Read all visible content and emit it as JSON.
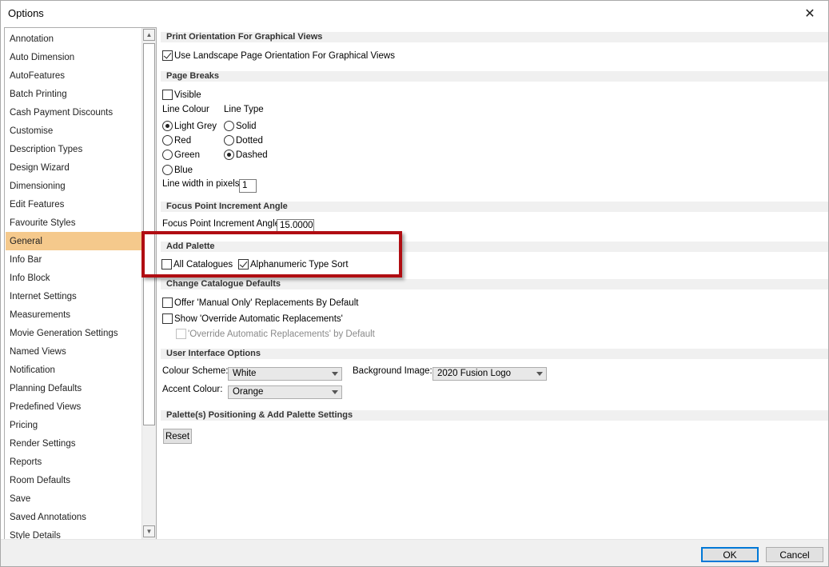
{
  "window": {
    "title": "Options",
    "close_glyph": "✕"
  },
  "sidebar": {
    "selected": "General",
    "items": [
      "Annotation",
      "Auto Dimension",
      "AutoFeatures",
      "Batch Printing",
      "Cash Payment Discounts",
      "Customise",
      "Description Types",
      "Design Wizard",
      "Dimensioning",
      "Edit Features",
      "Favourite Styles",
      "General",
      "Info Bar",
      "Info Block",
      "Internet Settings",
      "Measurements",
      "Movie Generation Settings",
      "Named Views",
      "Notification",
      "Planning Defaults",
      "Predefined Views",
      "Pricing",
      "Render Settings",
      "Reports",
      "Room Defaults",
      "Save",
      "Saved Annotations",
      "Style Details"
    ],
    "scroll_up_glyph": "▲",
    "scroll_down_glyph": "▼"
  },
  "print_orientation": {
    "header": "Print Orientation For Graphical Views",
    "landscape_label": "Use Landscape Page Orientation For Graphical Views",
    "landscape_checked": true
  },
  "page_breaks": {
    "header": "Page Breaks",
    "visible_label": "Visible",
    "visible_checked": false,
    "line_colour_label": "Line Colour",
    "line_type_label": "Line Type",
    "colours": [
      "Light Grey",
      "Red",
      "Green",
      "Blue"
    ],
    "selected_colour": "Light Grey",
    "types": [
      "Solid",
      "Dotted",
      "Dashed"
    ],
    "selected_type": "Dashed",
    "line_width_label": "Line width in pixels",
    "line_width_value": "1"
  },
  "focus_point": {
    "header": "Focus Point Increment Angle",
    "label": "Focus Point Increment Angle",
    "value": "15.0000"
  },
  "add_palette": {
    "header": "Add Palette",
    "all_catalogues_label": "All Catalogues",
    "all_catalogues_checked": false,
    "alpha_sort_label": "Alphanumeric Type Sort",
    "alpha_sort_checked": true
  },
  "catalogue_defaults": {
    "header": "Change Catalogue Defaults",
    "manual_only_label": "Offer 'Manual Only' Replacements By Default",
    "manual_only_checked": false,
    "show_override_label": "Show 'Override Automatic Replacements'",
    "show_override_checked": false,
    "override_default_label": "'Override Automatic Replacements' by Default",
    "override_default_checked": false
  },
  "ui_options": {
    "header": "User Interface Options",
    "colour_scheme_label": "Colour Scheme:",
    "colour_scheme_value": "White",
    "background_image_label": "Background Image:",
    "background_image_value": "2020 Fusion Logo",
    "accent_colour_label": "Accent Colour:",
    "accent_colour_value": "Orange"
  },
  "palette_positioning": {
    "header": "Palette(s) Positioning & Add Palette Settings",
    "reset_label": "Reset"
  },
  "footer": {
    "ok_label": "OK",
    "cancel_label": "Cancel"
  },
  "colors": {
    "selection": "#f5c98c",
    "highlight_box": "#b00d12",
    "section_bg": "#f0f0f0"
  }
}
